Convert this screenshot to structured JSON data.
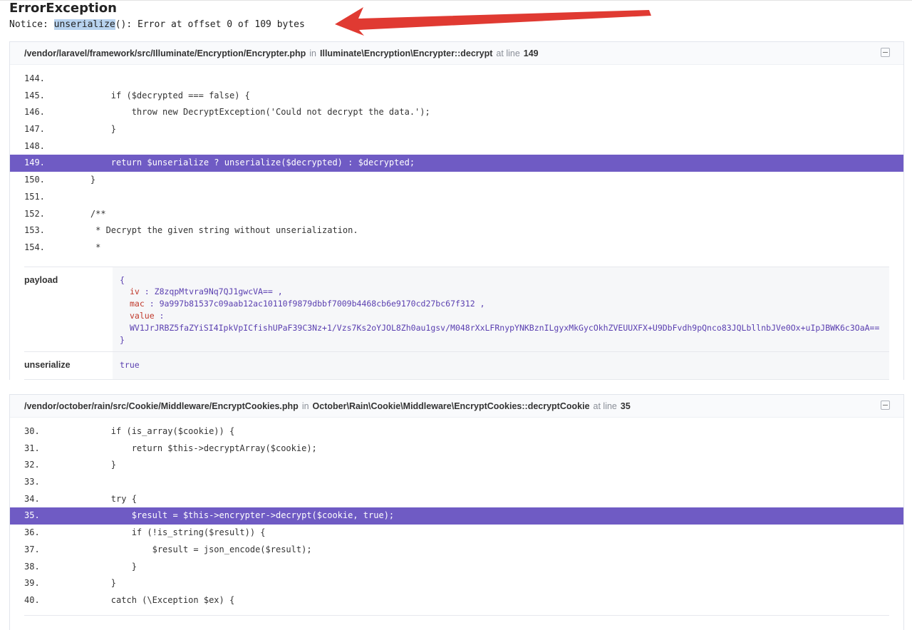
{
  "error": {
    "title": "ErrorException",
    "message_prefix": "Notice: ",
    "message_highlight": "unserialize",
    "message_suffix": "(): Error at offset 0 of 109 bytes"
  },
  "annotation": {
    "arrow_color": "#e03a32",
    "icon": "arrow-left-icon"
  },
  "colors": {
    "active_line": "#6f5bc4",
    "argument_value": "#5a3fb0",
    "argument_key": "#c0392b"
  },
  "frames": [
    {
      "file": "/vendor/laravel/framework/src/Illuminate/Encryption/Encrypter.php",
      "in_label": "in",
      "class_method": "Illuminate\\Encryption\\Encrypter::decrypt",
      "at_line_label": "at line",
      "line": "149",
      "code": [
        {
          "n": "144.",
          "code": ""
        },
        {
          "n": "145.",
          "code": "        if ($decrypted === false) {"
        },
        {
          "n": "146.",
          "code": "            throw new DecryptException('Could not decrypt the data.');"
        },
        {
          "n": "147.",
          "code": "        }"
        },
        {
          "n": "148.",
          "code": ""
        },
        {
          "n": "149.",
          "code": "        return $unserialize ? unserialize($decrypted) : $decrypted;"
        },
        {
          "n": "150.",
          "code": "    }"
        },
        {
          "n": "151.",
          "code": ""
        },
        {
          "n": "152.",
          "code": "    /**"
        },
        {
          "n": "153.",
          "code": "     * Decrypt the given string without unserialization."
        },
        {
          "n": "154.",
          "code": "     *"
        }
      ],
      "args": {
        "payload": {
          "name": "payload",
          "open": "{",
          "iv_key": "iv",
          "iv_val": "Z8zqpMtvra9Nq7QJ1gwcVA== ,",
          "mac_key": "mac",
          "mac_val": "9a997b81537c09aab12ac10110f9879dbbf7009b4468cb6e9170cd27bc67f312 ,",
          "value_key": "value",
          "value_val": "WV1JrJRBZ5faZYiSI4IpkVpICfishUPaF39C3Nz+1/Vzs7Ks2oYJOL8Zh0au1gsv/M048rXxLFRnypYNKBznILgyxMkGycOkhZVEUUXFX+U9DbFvdh9pQnco83JQLbllnbJVe0Ox+uIpJBWK6c3OaA==",
          "close": "}",
          "sep": " :"
        },
        "unserialize": {
          "name": "unserialize",
          "value": "true"
        }
      }
    },
    {
      "file": "/vendor/october/rain/src/Cookie/Middleware/EncryptCookies.php",
      "in_label": "in",
      "class_method": "October\\Rain\\Cookie\\Middleware\\EncryptCookies::decryptCookie",
      "at_line_label": "at line",
      "line": "35",
      "code": [
        {
          "n": "30.",
          "code": "        if (is_array($cookie)) {"
        },
        {
          "n": "31.",
          "code": "            return $this->decryptArray($cookie);"
        },
        {
          "n": "32.",
          "code": "        }"
        },
        {
          "n": "33.",
          "code": ""
        },
        {
          "n": "34.",
          "code": "        try {"
        },
        {
          "n": "35.",
          "code": "            $result = $this->encrypter->decrypt($cookie, true);"
        },
        {
          "n": "36.",
          "code": "            if (!is_string($result)) {"
        },
        {
          "n": "37.",
          "code": "                $result = json_encode($result);"
        },
        {
          "n": "38.",
          "code": "            }"
        },
        {
          "n": "39.",
          "code": "        }"
        },
        {
          "n": "40.",
          "code": "        catch (\\Exception $ex) {"
        }
      ]
    }
  ]
}
